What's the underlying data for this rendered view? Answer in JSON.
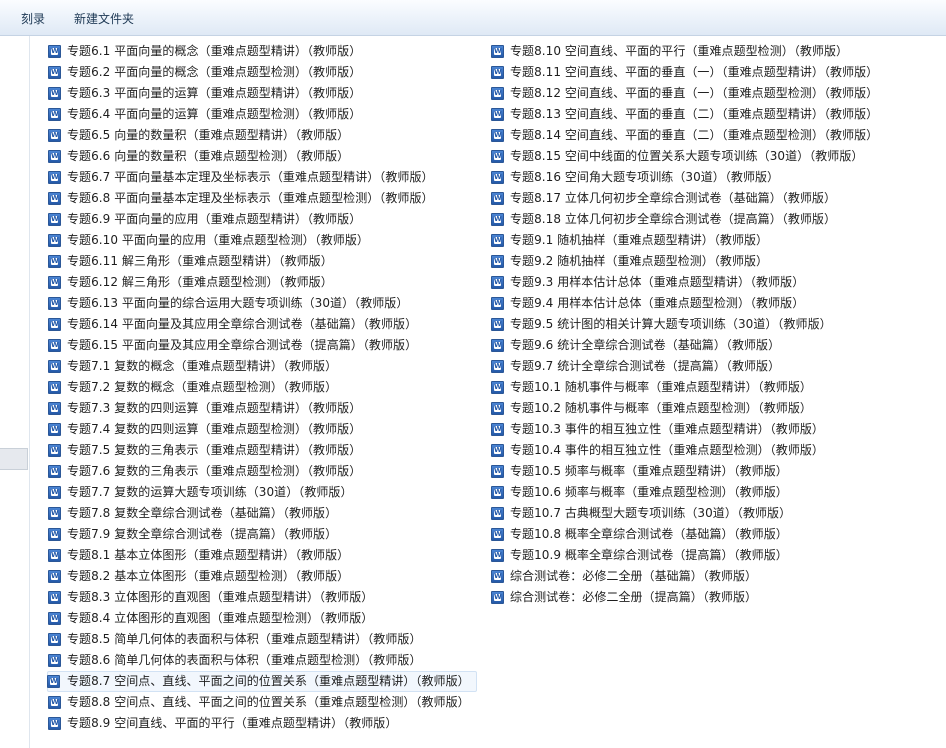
{
  "toolbar": {
    "burn_label": "刻录",
    "new_folder_label": "新建文件夹"
  },
  "files_left": [
    "专题6.1 平面向量的概念（重难点题型精讲）（教师版）",
    "专题6.2 平面向量的概念（重难点题型检测）（教师版）",
    "专题6.3 平面向量的运算（重难点题型精讲）（教师版）",
    "专题6.4 平面向量的运算（重难点题型检测）（教师版）",
    "专题6.5 向量的数量积（重难点题型精讲）（教师版）",
    "专题6.6 向量的数量积（重难点题型检测）（教师版）",
    "专题6.7 平面向量基本定理及坐标表示（重难点题型精讲）（教师版）",
    "专题6.8 平面向量基本定理及坐标表示（重难点题型检测）（教师版）",
    "专题6.9 平面向量的应用（重难点题型精讲）（教师版）",
    "专题6.10 平面向量的应用（重难点题型检测）（教师版）",
    "专题6.11 解三角形（重难点题型精讲）（教师版）",
    "专题6.12 解三角形（重难点题型检测）（教师版）",
    "专题6.13 平面向量的综合运用大题专项训练（30道）（教师版）",
    "专题6.14 平面向量及其应用全章综合测试卷（基础篇）（教师版）",
    "专题6.15 平面向量及其应用全章综合测试卷（提高篇）（教师版）",
    "专题7.1 复数的概念（重难点题型精讲）（教师版）",
    "专题7.2 复数的概念（重难点题型检测）（教师版）",
    "专题7.3 复数的四则运算（重难点题型精讲）（教师版）",
    "专题7.4 复数的四则运算（重难点题型检测）（教师版）",
    "专题7.5 复数的三角表示（重难点题型精讲）（教师版）",
    "专题7.6 复数的三角表示（重难点题型检测）（教师版）",
    "专题7.7 复数的运算大题专项训练（30道）（教师版）",
    "专题7.8 复数全章综合测试卷（基础篇）（教师版）",
    "专题7.9 复数全章综合测试卷（提高篇）（教师版）",
    "专题8.1 基本立体图形（重难点题型精讲）（教师版）",
    "专题8.2 基本立体图形（重难点题型检测）（教师版）",
    "专题8.3 立体图形的直观图（重难点题型精讲）（教师版）",
    "专题8.4 立体图形的直观图（重难点题型检测）（教师版）",
    "专题8.5 简单几何体的表面积与体积（重难点题型精讲）（教师版）",
    "专题8.6 简单几何体的表面积与体积（重难点题型检测）（教师版）",
    "专题8.7 空间点、直线、平面之间的位置关系（重难点题型精讲）（教师版）",
    "专题8.8 空间点、直线、平面之间的位置关系（重难点题型检测）（教师版）",
    "专题8.9 空间直线、平面的平行（重难点题型精讲）（教师版）"
  ],
  "files_right": [
    "专题8.10 空间直线、平面的平行（重难点题型检测）（教师版）",
    "专题8.11 空间直线、平面的垂直（一）（重难点题型精讲）（教师版）",
    "专题8.12 空间直线、平面的垂直（一）（重难点题型检测）（教师版）",
    "专题8.13 空间直线、平面的垂直（二）（重难点题型精讲）（教师版）",
    "专题8.14 空间直线、平面的垂直（二）（重难点题型检测）（教师版）",
    "专题8.15 空间中线面的位置关系大题专项训练（30道）（教师版）",
    "专题8.16 空间角大题专项训练（30道）（教师版）",
    "专题8.17 立体几何初步全章综合测试卷（基础篇）（教师版）",
    "专题8.18 立体几何初步全章综合测试卷（提高篇）（教师版）",
    "专题9.1 随机抽样（重难点题型精讲）（教师版）",
    "专题9.2 随机抽样（重难点题型检测）（教师版）",
    "专题9.3 用样本估计总体（重难点题型精讲）（教师版）",
    "专题9.4 用样本估计总体（重难点题型检测）（教师版）",
    "专题9.5 统计图的相关计算大题专项训练（30道）（教师版）",
    "专题9.6 统计全章综合测试卷（基础篇）（教师版）",
    "专题9.7 统计全章综合测试卷（提高篇）（教师版）",
    "专题10.1 随机事件与概率（重难点题型精讲）（教师版）",
    "专题10.2 随机事件与概率（重难点题型检测）（教师版）",
    "专题10.3 事件的相互独立性（重难点题型精讲）（教师版）",
    "专题10.4 事件的相互独立性（重难点题型检测）（教师版）",
    "专题10.5 频率与概率（重难点题型精讲）（教师版）",
    "专题10.6 频率与概率（重难点题型检测）（教师版）",
    "专题10.7 古典概型大题专项训练（30道）（教师版）",
    "专题10.8 概率全章综合测试卷（基础篇）（教师版）",
    "专题10.9 概率全章综合测试卷（提高篇）（教师版）",
    "综合测试卷：必修二全册（基础篇）（教师版）",
    "综合测试卷：必修二全册（提高篇）（教师版）"
  ],
  "selected_left_index": 30,
  "file_icon": "word-document-icon",
  "colors": {
    "toolbar_text": "#1e3955",
    "selection_bg": "#f2f7fd",
    "selection_border": "#d2e2f4",
    "word_icon": "#2459a8"
  }
}
